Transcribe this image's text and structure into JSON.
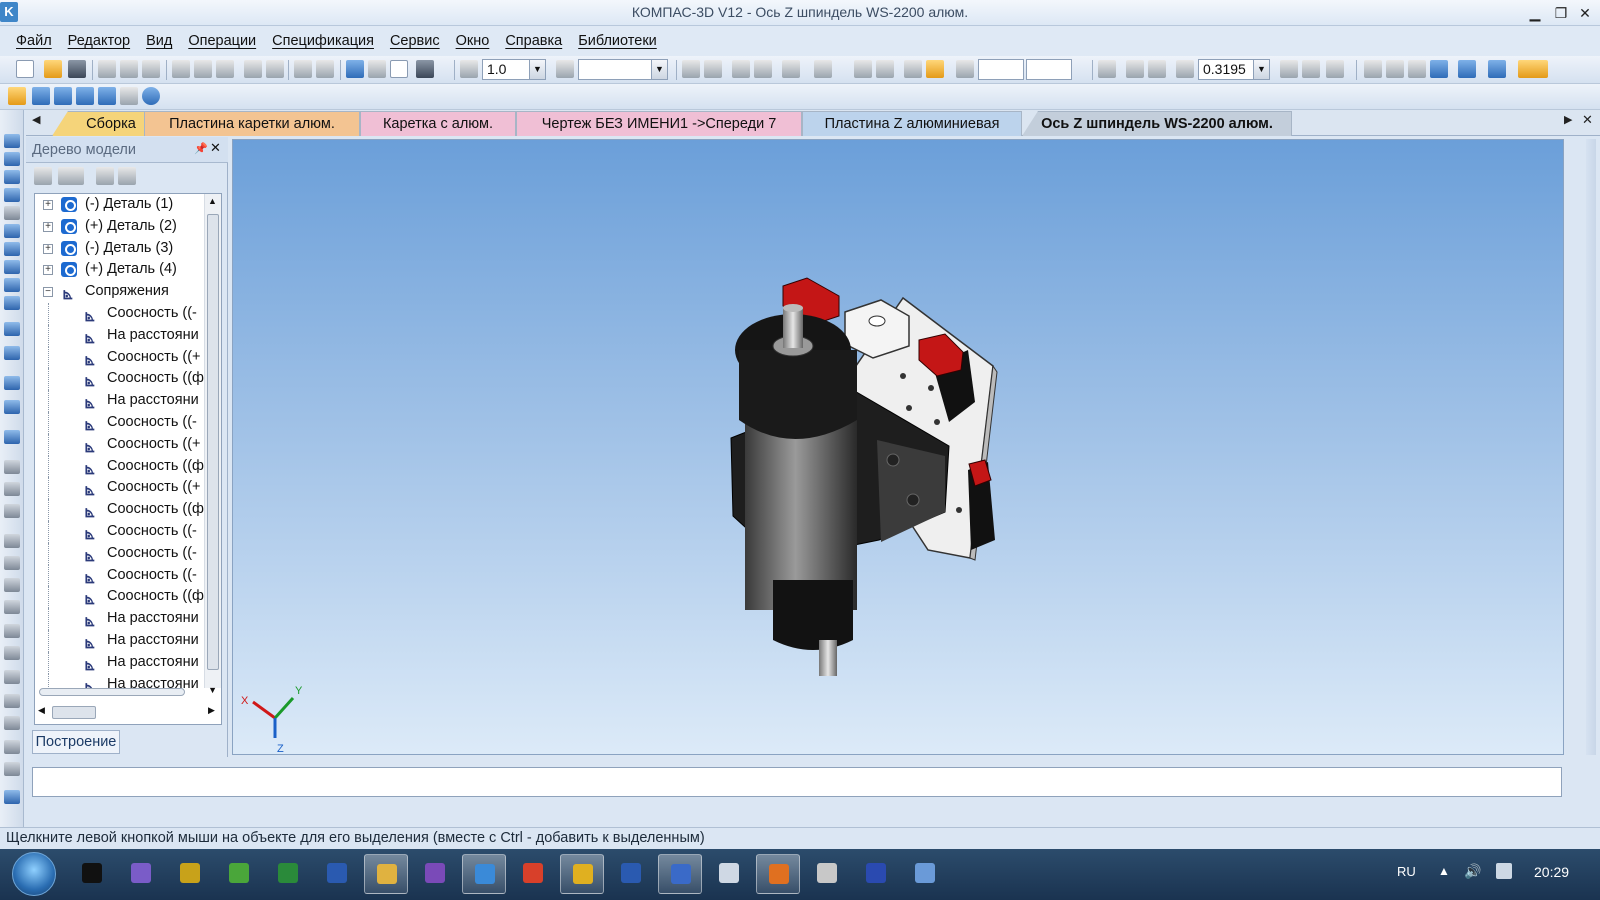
{
  "window": {
    "title": "КОМПАС-3D V12 - Ось Z шпиндель WS-2200 алюм.",
    "app_icon_glyph": "K"
  },
  "menu": [
    "Файл",
    "Редактор",
    "Вид",
    "Операции",
    "Спецификация",
    "Сервис",
    "Окно",
    "Справка",
    "Библиотеки"
  ],
  "toolbar": {
    "scale_value": "1.0",
    "zoom_value": "0.3195",
    "layer_value": ""
  },
  "tabs": [
    {
      "label": "Сборка",
      "color": "#f5d47a"
    },
    {
      "label": "Пластина каретки алюм.",
      "color": "#f3c492"
    },
    {
      "label": "Каретка с  алюм.",
      "color": "#f0bfd5"
    },
    {
      "label": "Чертеж БЕЗ ИМЕНИ1 ->Спереди 7",
      "color": "#f0bfd5"
    },
    {
      "label": "Пластина Z алюминиевая",
      "color": "#bcd3ec"
    },
    {
      "label": "Ось Z шпиндель WS-2200 алюм.",
      "color": "#c3cedb",
      "active": true
    }
  ],
  "model_tree": {
    "title": "Дерево модели",
    "items": [
      {
        "label": "(-) Деталь (1)",
        "type": "part",
        "level": 0,
        "expander": "+"
      },
      {
        "label": "(+) Деталь (2)",
        "type": "part",
        "level": 0,
        "expander": "+"
      },
      {
        "label": "(-) Деталь (3)",
        "type": "part",
        "level": 0,
        "expander": "+"
      },
      {
        "label": "(+) Деталь (4)",
        "type": "part",
        "level": 0,
        "expander": "+"
      },
      {
        "label": "Сопряжения",
        "type": "mates",
        "level": 0,
        "expander": "−"
      },
      {
        "label": "Соосность ((-",
        "type": "mate",
        "level": 1
      },
      {
        "label": "На расстояни",
        "type": "mate",
        "level": 1
      },
      {
        "label": "Соосность ((+",
        "type": "mate",
        "level": 1
      },
      {
        "label": "Соосность ((ф",
        "type": "mate",
        "level": 1
      },
      {
        "label": "На расстояни",
        "type": "mate",
        "level": 1
      },
      {
        "label": "Соосность ((-",
        "type": "mate",
        "level": 1
      },
      {
        "label": "Соосность ((+",
        "type": "mate",
        "level": 1
      },
      {
        "label": "Соосность ((ф",
        "type": "mate",
        "level": 1
      },
      {
        "label": "Соосность ((+",
        "type": "mate",
        "level": 1
      },
      {
        "label": "Соосность ((ф",
        "type": "mate",
        "level": 1
      },
      {
        "label": "Соосность ((-",
        "type": "mate",
        "level": 1
      },
      {
        "label": "Соосность ((-",
        "type": "mate",
        "level": 1
      },
      {
        "label": "Соосность ((-",
        "type": "mate",
        "level": 1
      },
      {
        "label": "Соосность ((ф",
        "type": "mate",
        "level": 1
      },
      {
        "label": "На расстояни",
        "type": "mate",
        "level": 1
      },
      {
        "label": "На расстояни",
        "type": "mate",
        "level": 1
      },
      {
        "label": "На расстояни",
        "type": "mate",
        "level": 1
      },
      {
        "label": "На расстояни",
        "type": "mate",
        "level": 1
      }
    ],
    "bottom_tab": "Построение"
  },
  "viewport": {
    "axis_labels": {
      "x": "X",
      "y": "Y",
      "z": "Z"
    }
  },
  "status": {
    "message": "Щелкните левой кнопкой мыши на объекте для его выделения (вместе с Ctrl - добавить к выделенным)"
  },
  "taskbar": {
    "language": "RU",
    "clock": "20:29",
    "apps": [
      "app-black-icon",
      "itunes-icon",
      "app-yellow-icon",
      "app-green-icon",
      "excel-icon",
      "word-icon",
      "explorer-icon",
      "onenote-icon",
      "app-blue-icon",
      "chrome-icon",
      "app-target-icon",
      "kompas-icon",
      "app-globe-icon",
      "notepad-icon",
      "media-icon",
      "paint-icon",
      "save-icon",
      "network-icon"
    ]
  }
}
